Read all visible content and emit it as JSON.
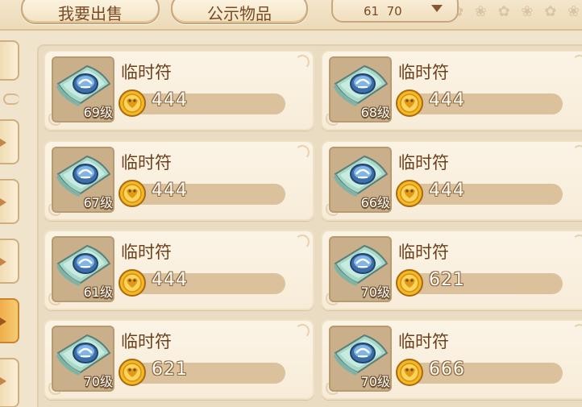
{
  "header": {
    "tab_sell": "我要出售",
    "tab_public": "公示物品",
    "level_range": "61  70"
  },
  "colors": {
    "background": "#f1e4cc",
    "card": "#f7ecd8",
    "name_text": "#6e3f1c",
    "price_bar": "#dcc19d",
    "coin_gold": "#f5b820",
    "active_tab": "#efae4a"
  },
  "items": [
    {
      "name": "临时符",
      "level": "69级",
      "price": "444",
      "icon": "talisman-icon"
    },
    {
      "name": "临时符",
      "level": "68级",
      "price": "444",
      "icon": "talisman-icon"
    },
    {
      "name": "临时符",
      "level": "67级",
      "price": "444",
      "icon": "talisman-icon"
    },
    {
      "name": "临时符",
      "level": "66级",
      "price": "444",
      "icon": "talisman-icon"
    },
    {
      "name": "临时符",
      "level": "61级",
      "price": "444",
      "icon": "talisman-icon"
    },
    {
      "name": "临时符",
      "level": "70级",
      "price": "621",
      "icon": "talisman-icon"
    },
    {
      "name": "临时符",
      "level": "70级",
      "price": "621",
      "icon": "talisman-icon"
    },
    {
      "name": "临时符",
      "level": "70级",
      "price": "666",
      "icon": "talisman-icon"
    }
  ]
}
